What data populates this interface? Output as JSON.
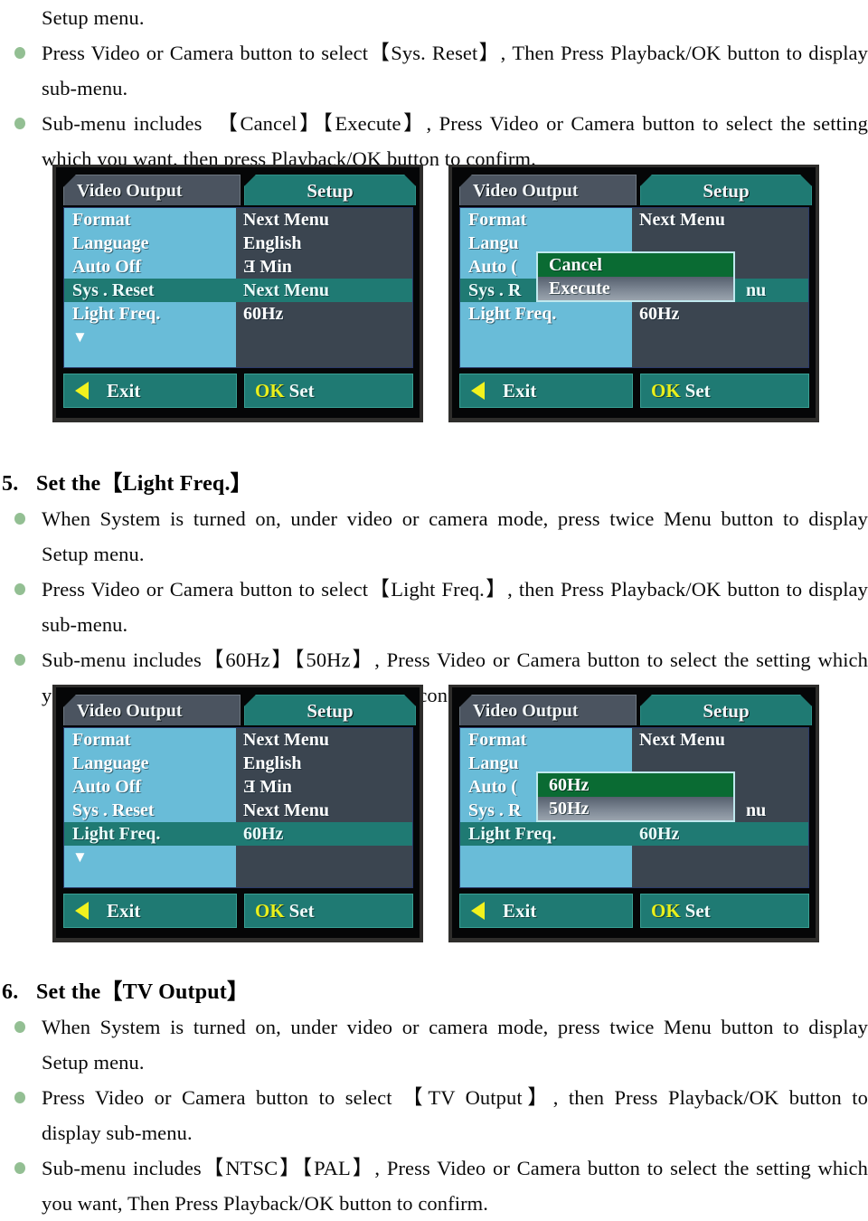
{
  "document": {
    "top_section": {
      "continuation_line": "Setup menu.",
      "bullets": [
        {
          "lines": [
            "Press Video or Camera button to select【Sys. Reset】, Then Press Playback/OK button to display",
            "sub-menu."
          ]
        },
        {
          "lines": [
            "Sub-menu includes  【Cancel】【Execute】, Press Video or Camera button to select the setting",
            "which you want, then press Playback/OK button to confirm."
          ]
        }
      ]
    },
    "section_5": {
      "number": "5.",
      "heading": "Set the【Light Freq.】",
      "bullets": [
        {
          "lines": [
            "When System is turned on, under video or camera mode, press twice Menu button to display",
            "Setup menu."
          ]
        },
        {
          "lines": [
            "Press Video or Camera button to select【Light Freq.】, then Press Playback/OK button to display",
            "sub-menu."
          ]
        },
        {
          "lines": [
            "Sub-menu includes【60Hz】【50Hz】, Press Video or Camera button to select the setting which",
            "you want, Then Press Playback/OK button to confirm."
          ]
        }
      ]
    },
    "section_6": {
      "number": "6.",
      "heading": "Set the【TV Output】",
      "bullets": [
        {
          "lines": [
            "When System is turned on, under video or camera mode, press twice Menu button to display",
            "Setup menu."
          ]
        },
        {
          "lines": [
            "Press Video or Camera button to select 【TV Output】, then Press Playback/OK button to",
            "display sub-menu."
          ]
        },
        {
          "lines": [
            "Sub-menu includes【NTSC】【PAL】, Press Video or Camera button to select the setting which",
            "you want, Then Press Playback/OK button to confirm."
          ]
        }
      ]
    }
  },
  "osd_screens": {
    "common": {
      "tab_inactive": "Video Output",
      "tab_active": "Setup",
      "exit_label": "Exit",
      "ok_prefix": "OK",
      "ok_label": "Set",
      "scroll_down_arrow": "▼",
      "left_triangle_icon": "◀"
    },
    "screen_1": {
      "left_items": [
        "Format",
        "Language",
        "Auto Off",
        "Sys . Reset",
        "Light Freq."
      ],
      "right_items": [
        "Next Menu",
        "English",
        "Ǝ Min",
        "Next Menu",
        "60Hz"
      ],
      "selected_index": 3,
      "popup": null
    },
    "screen_2": {
      "left_items": [
        "Format",
        "Langu",
        "Auto (",
        "Sys . R",
        "Light Freq."
      ],
      "right_items": [
        "Next Menu",
        "",
        "",
        "nu",
        "60Hz"
      ],
      "selected_index": 3,
      "popup": {
        "options": [
          "Cancel",
          "Execute"
        ],
        "selected_index": 0
      }
    },
    "screen_3": {
      "left_items": [
        "Format",
        "Language",
        "Auto Off",
        "Sys . Reset",
        "Light Freq."
      ],
      "right_items": [
        "Next Menu",
        "English",
        "Ǝ Min",
        "Next Menu",
        "60Hz"
      ],
      "selected_index": 4,
      "popup": null
    },
    "screen_4": {
      "left_items": [
        "Format",
        "Langu",
        "Auto (",
        "Sys . R",
        "Light Freq."
      ],
      "right_items": [
        "Next Menu",
        "",
        "",
        "nu",
        "60Hz"
      ],
      "selected_index": 4,
      "popup": {
        "options": [
          "60Hz",
          "50Hz"
        ],
        "selected_index": 0
      }
    }
  },
  "colors": {
    "menu_left_bg": "#69bcd8",
    "menu_right_bg": "#3b4550",
    "highlight_teal": "#1f7a73",
    "popup_selected_green": "#0a6b33",
    "accent_yellow": "#e9f01c",
    "bullet_green": "#93bf93",
    "panel_frame": "#2e2d2b"
  }
}
